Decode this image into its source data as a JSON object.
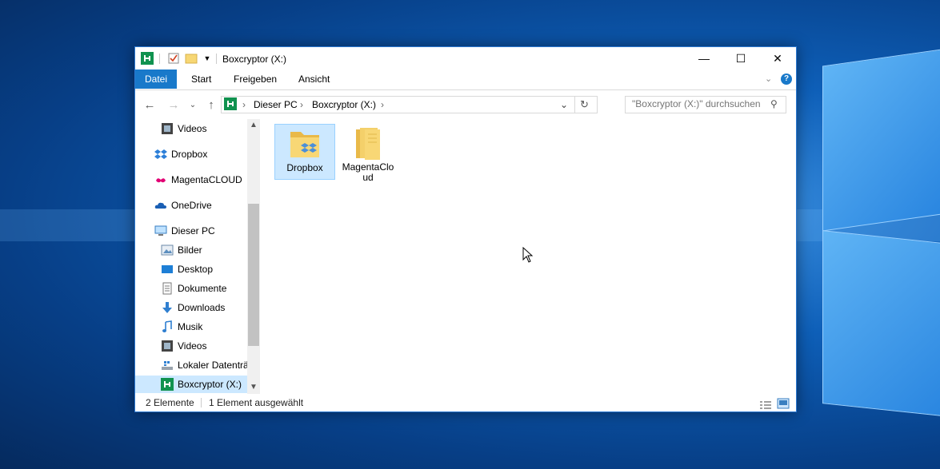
{
  "window": {
    "title": "Boxcryptor (X:)",
    "controls": {
      "minimize": "—",
      "maximize": "☐",
      "close": "✕"
    }
  },
  "ribbon": {
    "tabs": [
      {
        "label": "Datei",
        "active": true
      },
      {
        "label": "Start"
      },
      {
        "label": "Freigeben"
      },
      {
        "label": "Ansicht"
      }
    ]
  },
  "address": {
    "crumbs": [
      "Dieser PC",
      "Boxcryptor (X:)"
    ],
    "search_placeholder": "\"Boxcryptor (X:)\" durchsuchen"
  },
  "nav": {
    "items": [
      {
        "label": "Videos",
        "icon": "video-icon"
      },
      {
        "label": "Dropbox",
        "icon": "dropbox-icon"
      },
      {
        "label": "MagentaCLOUD",
        "icon": "magentacloud-icon"
      },
      {
        "label": "OneDrive",
        "icon": "onedrive-icon"
      },
      {
        "label": "Dieser PC",
        "icon": "computer-icon"
      },
      {
        "label": "Bilder",
        "icon": "pictures-icon"
      },
      {
        "label": "Desktop",
        "icon": "desktop-icon"
      },
      {
        "label": "Dokumente",
        "icon": "documents-icon"
      },
      {
        "label": "Downloads",
        "icon": "downloads-icon"
      },
      {
        "label": "Musik",
        "icon": "music-icon"
      },
      {
        "label": "Videos",
        "icon": "video-icon"
      },
      {
        "label": "Lokaler Datenträ",
        "icon": "local-drive-icon"
      },
      {
        "label": "Boxcryptor (X:)",
        "icon": "boxcryptor-icon",
        "selected": true
      }
    ]
  },
  "files": [
    {
      "label": "Dropbox",
      "selected": true
    },
    {
      "label": "MagentaCloud"
    }
  ],
  "status": {
    "count": "2 Elemente",
    "selection": "1 Element ausgewählt"
  },
  "colors": {
    "accent": "#1979ca",
    "selection": "#cce8ff",
    "boxcryptor": "#10924f"
  }
}
